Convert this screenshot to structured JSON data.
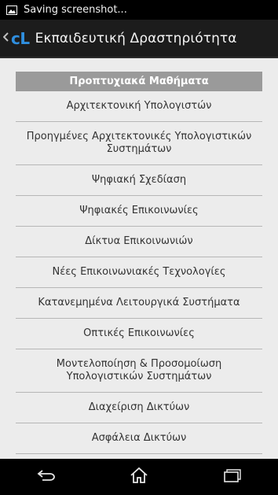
{
  "statusbar": {
    "notification_text": "Saving screenshot...",
    "icon": "image-icon"
  },
  "actionbar": {
    "up_icon": "chevron-left-icon",
    "logo_text": "cL",
    "title": "Εκπαιδευτική Δραστηριότητα"
  },
  "list": {
    "section_header": "Προπτυχιακά Μαθήματα",
    "items": [
      "Αρχιτεκτονική Υπολογιστών",
      "Προηγμένες Αρχιτεκτονικές Υπολογιστικών Συστημάτων",
      "Ψηφιακή Σχεδίαση",
      "Ψηφιακές Επικοινωνίες",
      "Δίκτυα Επικοινωνιών",
      "Νέες Επικοινωνιακές Τεχνολογίες",
      "Κατανεμημένα Λειτουργικά Συστήματα",
      "Οπτικές Επικοινωνίες",
      "Μοντελοποίηση & Προσομοίωση Υπολογιστικών Συστημάτων",
      "Διαχείριση Δικτύων",
      "Ασφάλεια Δικτύων"
    ]
  },
  "navbar": {
    "back_icon": "back-icon",
    "home_icon": "home-icon",
    "recents_icon": "recents-icon"
  },
  "colors": {
    "logo": "#2f8fe0",
    "header_bg": "#9a9a9a",
    "content_bg": "#ececec"
  }
}
